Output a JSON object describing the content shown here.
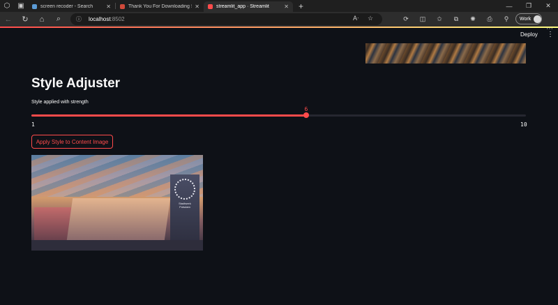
{
  "browser": {
    "tabs": [
      {
        "title": "screen recoder - Search",
        "favicon_color": "#5b9bd5",
        "active": false
      },
      {
        "title": "Thank You For Downloading Scr",
        "favicon_color": "#d14a3a",
        "active": false
      },
      {
        "title": "streamlit_app · Streamlit",
        "favicon_color": "#ff4b4b",
        "active": true
      }
    ],
    "url_host": "localhost",
    "url_port": ":8502",
    "profile_label": "Work",
    "toolbar_icons": [
      "read-aloud-icon",
      "favorite-star-icon",
      "refresh-icon",
      "split-screen-icon",
      "favorites-icon",
      "collections-icon",
      "copilot-icon",
      "screenshot-icon",
      "extensions-icon"
    ]
  },
  "app": {
    "deploy_label": "Deploy",
    "title": "Style Adjuster",
    "slider": {
      "label": "Style applied with strength",
      "min": 1,
      "max": 10,
      "value": 6,
      "min_label": "1",
      "max_label": "10",
      "value_label": "6"
    },
    "apply_button": "Apply Style to Content Image",
    "result_image": {
      "sign_text": "Stadtwerk Potsdam"
    }
  },
  "colors": {
    "accent": "#ff4b4b",
    "background": "#0e1117",
    "text": "#fafafa"
  }
}
